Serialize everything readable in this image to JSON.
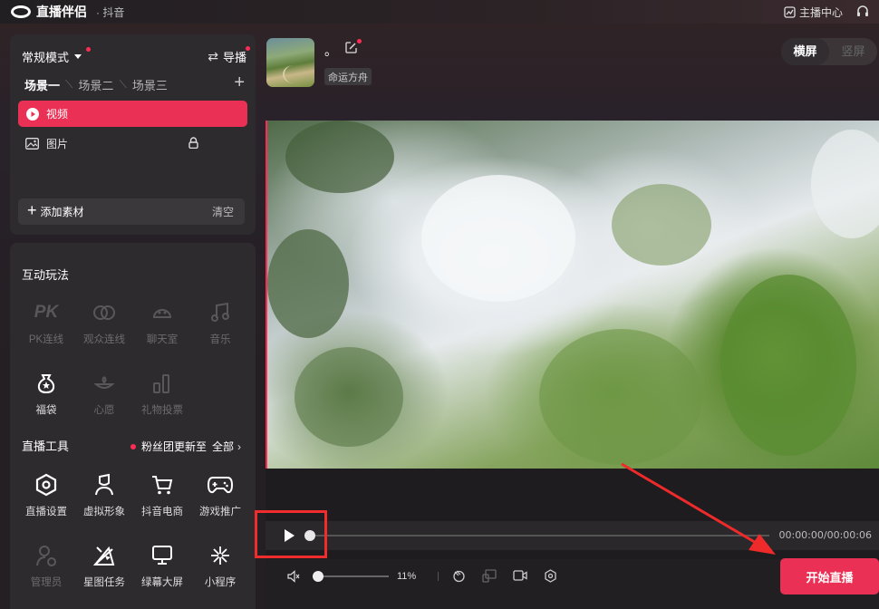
{
  "app": {
    "title": "直播伴侣",
    "subtitle": "· 抖音"
  },
  "titlebar": {
    "anchor_center": "主播中心"
  },
  "mode": {
    "label": "常规模式",
    "guide": "导播"
  },
  "scenes": [
    "场景一",
    "场景二",
    "场景三"
  ],
  "sources": [
    {
      "label": "视频",
      "icon": "play-circle-icon",
      "active": true
    },
    {
      "label": "图片",
      "icon": "image-icon",
      "locked": true
    }
  ],
  "add_source": {
    "label": "添加素材",
    "clear": "清空"
  },
  "interactive": {
    "title": "互动玩法",
    "items": [
      {
        "label": "PK连线",
        "icon": "pk-icon",
        "enabled": false
      },
      {
        "label": "观众连线",
        "icon": "link-icon",
        "enabled": false
      },
      {
        "label": "聊天室",
        "icon": "chatroom-icon",
        "enabled": false
      },
      {
        "label": "音乐",
        "icon": "music-icon",
        "enabled": false
      },
      {
        "label": "福袋",
        "icon": "lucky-bag-icon",
        "enabled": true
      },
      {
        "label": "心愿",
        "icon": "wish-icon",
        "enabled": false
      },
      {
        "label": "礼物投票",
        "icon": "gift-vote-icon",
        "enabled": false
      }
    ]
  },
  "tools": {
    "title": "直播工具",
    "fans_notice": "粉丝团更新至",
    "all": "全部",
    "items": [
      {
        "label": "直播设置",
        "icon": "hexagon-settings-icon",
        "enabled": true
      },
      {
        "label": "虚拟形象",
        "icon": "avatar-figure-icon",
        "enabled": true
      },
      {
        "label": "抖音电商",
        "icon": "cart-icon",
        "enabled": true
      },
      {
        "label": "游戏推广",
        "icon": "gamepad-icon",
        "enabled": true
      },
      {
        "label": "管理员",
        "icon": "admin-icon",
        "enabled": false
      },
      {
        "label": "星图任务",
        "icon": "star-map-icon",
        "enabled": true
      },
      {
        "label": "绿幕大屏",
        "icon": "monitor-icon",
        "enabled": true
      },
      {
        "label": "小程序",
        "icon": "mini-program-icon",
        "enabled": true
      }
    ]
  },
  "profile": {
    "nickname": "。",
    "tag": "命运方舟"
  },
  "orientation": {
    "landscape": "横屏",
    "portrait": "竖屏",
    "selected": "横屏"
  },
  "player": {
    "time": "00:00:00/00:00:06",
    "progress": 0
  },
  "volume": {
    "percent": "11%",
    "level": 0.11
  },
  "start_button": "开始直播",
  "colors": {
    "accent": "#ea3055",
    "highlight_box": "#f02c2c"
  }
}
